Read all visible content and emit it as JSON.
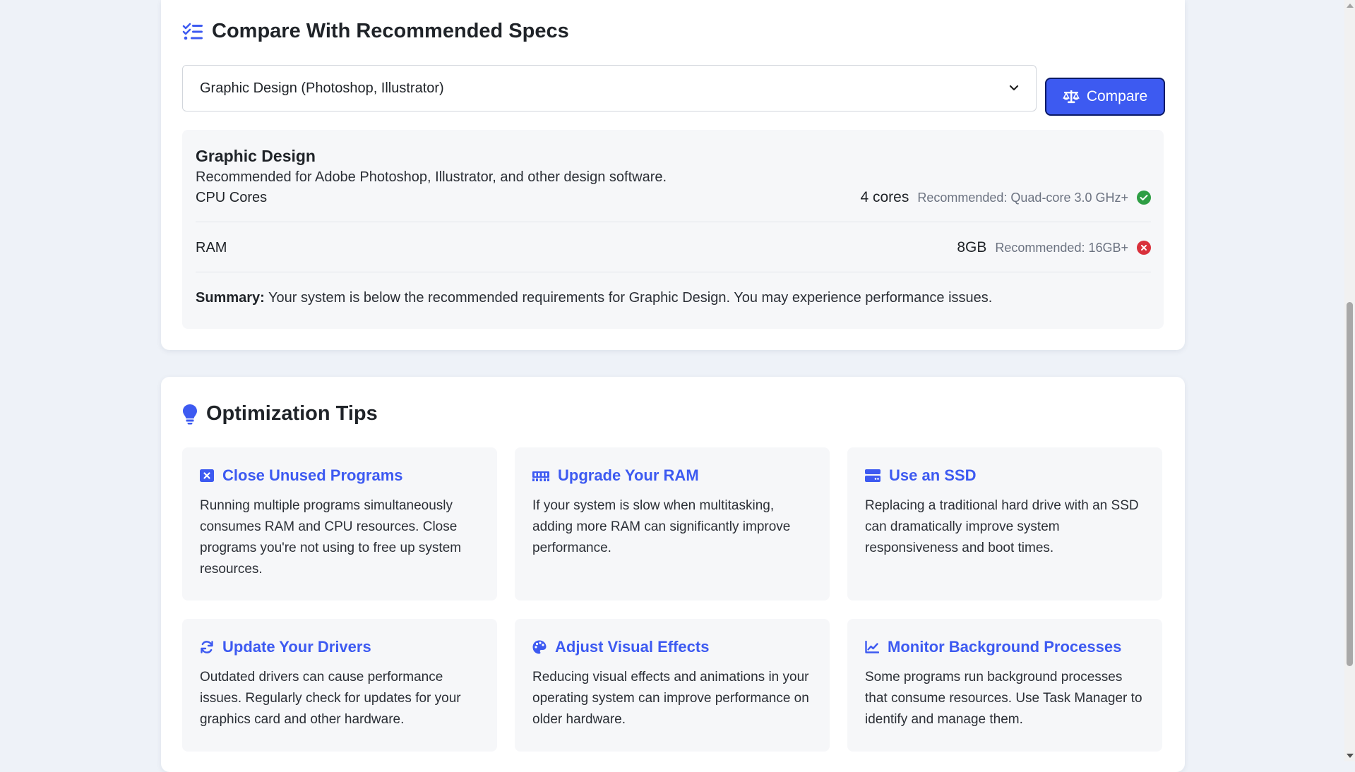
{
  "compare": {
    "title": "Compare With Recommended Specs",
    "select_value": "Graphic Design (Photoshop, Illustrator)",
    "compare_label": "Compare",
    "result": {
      "heading": "Graphic Design",
      "description": "Recommended for Adobe Photoshop, Illustrator, and other design software.",
      "specs": [
        {
          "label": "CPU Cores",
          "value": "4 cores",
          "recommended": "Recommended: Quad-core 3.0 GHz+",
          "status": "pass"
        },
        {
          "label": "RAM",
          "value": "8GB",
          "recommended": "Recommended: 16GB+",
          "status": "fail"
        }
      ],
      "summary_label": "Summary:",
      "summary_text": " Your system is below the recommended requirements for Graphic Design. You may experience performance issues."
    }
  },
  "tips": {
    "title": "Optimization Tips",
    "items": [
      {
        "title": "Close Unused Programs",
        "icon": "close-window-icon",
        "text": "Running multiple programs simultaneously consumes RAM and CPU resources. Close programs you're not using to free up system resources."
      },
      {
        "title": "Upgrade Your RAM",
        "icon": "memory-icon",
        "text": "If your system is slow when multitasking, adding more RAM can significantly improve performance."
      },
      {
        "title": "Use an SSD",
        "icon": "hard-drive-icon",
        "text": "Replacing a traditional hard drive with an SSD can dramatically improve system responsiveness and boot times."
      },
      {
        "title": "Update Your Drivers",
        "icon": "sync-icon",
        "text": "Outdated drivers can cause performance issues. Regularly check for updates for your graphics card and other hardware."
      },
      {
        "title": "Adjust Visual Effects",
        "icon": "palette-icon",
        "text": "Reducing visual effects and animations in your operating system can improve performance on older hardware."
      },
      {
        "title": "Monitor Background Processes",
        "icon": "chart-line-icon",
        "text": "Some programs run background processes that consume resources. Use Task Manager to identify and manage them."
      }
    ]
  },
  "colors": {
    "accent": "#3d5af1",
    "pass": "#2e9e44",
    "fail": "#d9303b",
    "background": "#eef2f8"
  }
}
